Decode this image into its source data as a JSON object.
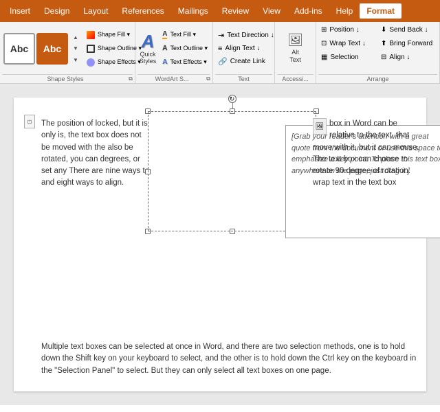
{
  "menu": {
    "items": [
      "Insert",
      "Design",
      "Layout",
      "References",
      "Mailings",
      "Review",
      "View",
      "Add-ins",
      "Help",
      "Format"
    ],
    "active": "Format"
  },
  "ribbon": {
    "shape_styles": {
      "label": "Shape Styles",
      "btn1_text": "Abc",
      "btn2_text": "Abc"
    },
    "wordart_styles": {
      "label": "WordArt S...",
      "icon": "A",
      "items": [
        "Text Fill",
        "Text Outline",
        "Text Effects"
      ]
    },
    "text_group": {
      "label": "Text",
      "direction_label": "Text Direction ↓",
      "align_label": "Align Text ↓",
      "create_link_label": "Create Link"
    },
    "accessibility": {
      "label": "Accessi...",
      "alt_text_label": "Alt Text"
    },
    "arrange": {
      "label": "Arrange",
      "position_label": "Position ↓",
      "wrap_text_label": "Wrap Text ↓",
      "selection_label": "Selection",
      "send_back_label": "Send Back ↓",
      "bring_forward_label": "Bring Forward",
      "align_label": "Align ↓"
    }
  },
  "document": {
    "left_text": "The position of locked, but it is only is, the text box does not be moved with the also be rotated, you can degrees, or set any There are nine ways to and eight ways to align.",
    "right_text": "box in Word can be relative to the text, that move with it, but it can mouse. The text box can choose to rotate 90 degree of rotation. wrap text in the text box",
    "floating_text": "[Grab your reader's attention with a great quote from the document or use this space to emphasize a key point. To place this text box anywhere on the page, just drag it.]",
    "bottom_text": "Multiple text boxes can be selected at once in Word, and there are two selection methods, one is to hold down the Shift key on your keyboard to select, and the other is to hold down the Ctrl key on the keyboard in the \"Selection Panel\" to select. But they can only select all text boxes on one page."
  }
}
